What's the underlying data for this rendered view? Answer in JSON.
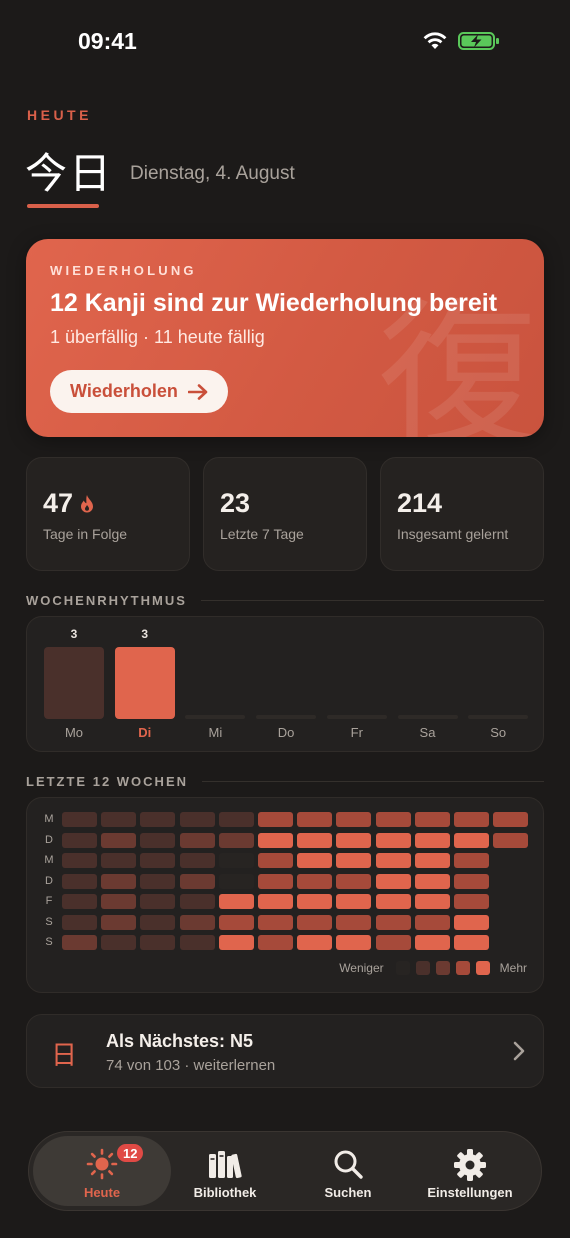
{
  "status": {
    "time": "09:41"
  },
  "header": {
    "eyebrow": "HEUTE",
    "title": "今日",
    "date": "Dienstag, 4. August"
  },
  "review": {
    "eyebrow": "WIEDERHOLUNG",
    "title": "12 Kanji sind zur Wiederholung bereit",
    "subtitle": "1 überfällig · 11 heute fällig",
    "button_label": "Wiederholen",
    "watermark": "復"
  },
  "stats": [
    {
      "value": "47",
      "label": "Tage in Folge",
      "icon": "flame-icon"
    },
    {
      "value": "23",
      "label": "Letzte 7 Tage"
    },
    {
      "value": "214",
      "label": "Insgesamt gelernt"
    }
  ],
  "weekly": {
    "heading": "WOCHENRHYTHMUS",
    "active_day": "Di",
    "days": [
      {
        "day": "Mo",
        "value": 3,
        "label": "3"
      },
      {
        "day": "Di",
        "value": 3,
        "label": "3"
      },
      {
        "day": "Mi",
        "value": 0,
        "label": ""
      },
      {
        "day": "Do",
        "value": 0,
        "label": ""
      },
      {
        "day": "Fr",
        "value": 0,
        "label": ""
      },
      {
        "day": "Sa",
        "value": 0,
        "label": ""
      },
      {
        "day": "So",
        "value": 0,
        "label": ""
      }
    ]
  },
  "heatmap": {
    "heading": "LETZTE 12 WOCHEN",
    "row_labels": [
      "M",
      "D",
      "M",
      "D",
      "F",
      "S",
      "S"
    ],
    "levels": [
      [
        1,
        1,
        1,
        1,
        1,
        3,
        3,
        3,
        3,
        3,
        3,
        3
      ],
      [
        1,
        2,
        1,
        2,
        2,
        4,
        4,
        4,
        4,
        4,
        4,
        3
      ],
      [
        1,
        1,
        1,
        1,
        0,
        3,
        4,
        4,
        4,
        4,
        3,
        -1
      ],
      [
        1,
        2,
        1,
        2,
        0,
        3,
        3,
        3,
        4,
        4,
        3,
        -1
      ],
      [
        1,
        2,
        1,
        1,
        4,
        4,
        4,
        4,
        4,
        4,
        3,
        -1
      ],
      [
        1,
        2,
        1,
        2,
        3,
        3,
        3,
        3,
        3,
        3,
        4,
        -1
      ],
      [
        2,
        1,
        1,
        1,
        4,
        3,
        4,
        4,
        3,
        4,
        4,
        -1
      ]
    ],
    "colors": [
      "#272422",
      "#4a302b",
      "#6b3a31",
      "#a64a3a",
      "#e0654d"
    ],
    "legend_less": "Weniger",
    "legend_more": "Mehr"
  },
  "next": {
    "icon": "日",
    "title": "Als Nächstes: N5",
    "subtitle": "74 von 103 · weiterlernen"
  },
  "tabs": [
    {
      "label": "Heute",
      "icon": "sun-icon",
      "badge": "12",
      "active": true
    },
    {
      "label": "Bibliothek",
      "icon": "books-icon"
    },
    {
      "label": "Suchen",
      "icon": "search-icon"
    },
    {
      "label": "Einstellungen",
      "icon": "gear-icon"
    }
  ],
  "colors": {
    "accent": "#e0654d",
    "background": "#1c1a19",
    "card": "#232120",
    "muted_bar": "#4a302b"
  }
}
